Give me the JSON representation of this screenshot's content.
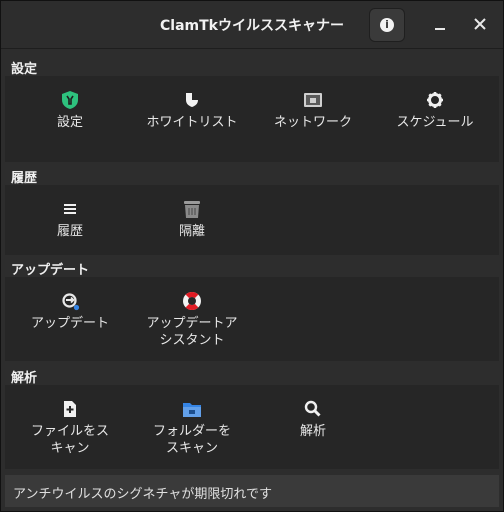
{
  "window": {
    "title": "ClamTkウイルススキャナー"
  },
  "sections": {
    "settings": {
      "header": "設定",
      "items": [
        {
          "label": "設定",
          "icon": "settings-shield-icon"
        },
        {
          "label": "ホワイトリスト",
          "icon": "whitelist-shield-icon"
        },
        {
          "label": "ネットワーク",
          "icon": "network-icon"
        },
        {
          "label": "スケジュール",
          "icon": "gear-icon"
        }
      ]
    },
    "history": {
      "header": "履歴",
      "items": [
        {
          "label": "履歴",
          "icon": "list-icon"
        },
        {
          "label": "隔離",
          "icon": "trash-icon"
        }
      ]
    },
    "update": {
      "header": "アップデート",
      "items": [
        {
          "label": "アップデート",
          "icon": "sync-icon"
        },
        {
          "label": "アップデートアシスタント",
          "icon": "lifebuoy-icon"
        }
      ]
    },
    "analysis": {
      "header": "解析",
      "items": [
        {
          "label": "ファイルをスキャン",
          "icon": "file-add-icon"
        },
        {
          "label": "フォルダーをスキャン",
          "icon": "folder-icon"
        },
        {
          "label": "解析",
          "icon": "search-icon"
        }
      ]
    }
  },
  "status": {
    "text": "アンチウイルスのシグネチャが期限切れです"
  },
  "colors": {
    "accent_blue": "#3584e4",
    "lifebuoy_red": "#e01b24",
    "shield_green": "#2ec27e"
  }
}
